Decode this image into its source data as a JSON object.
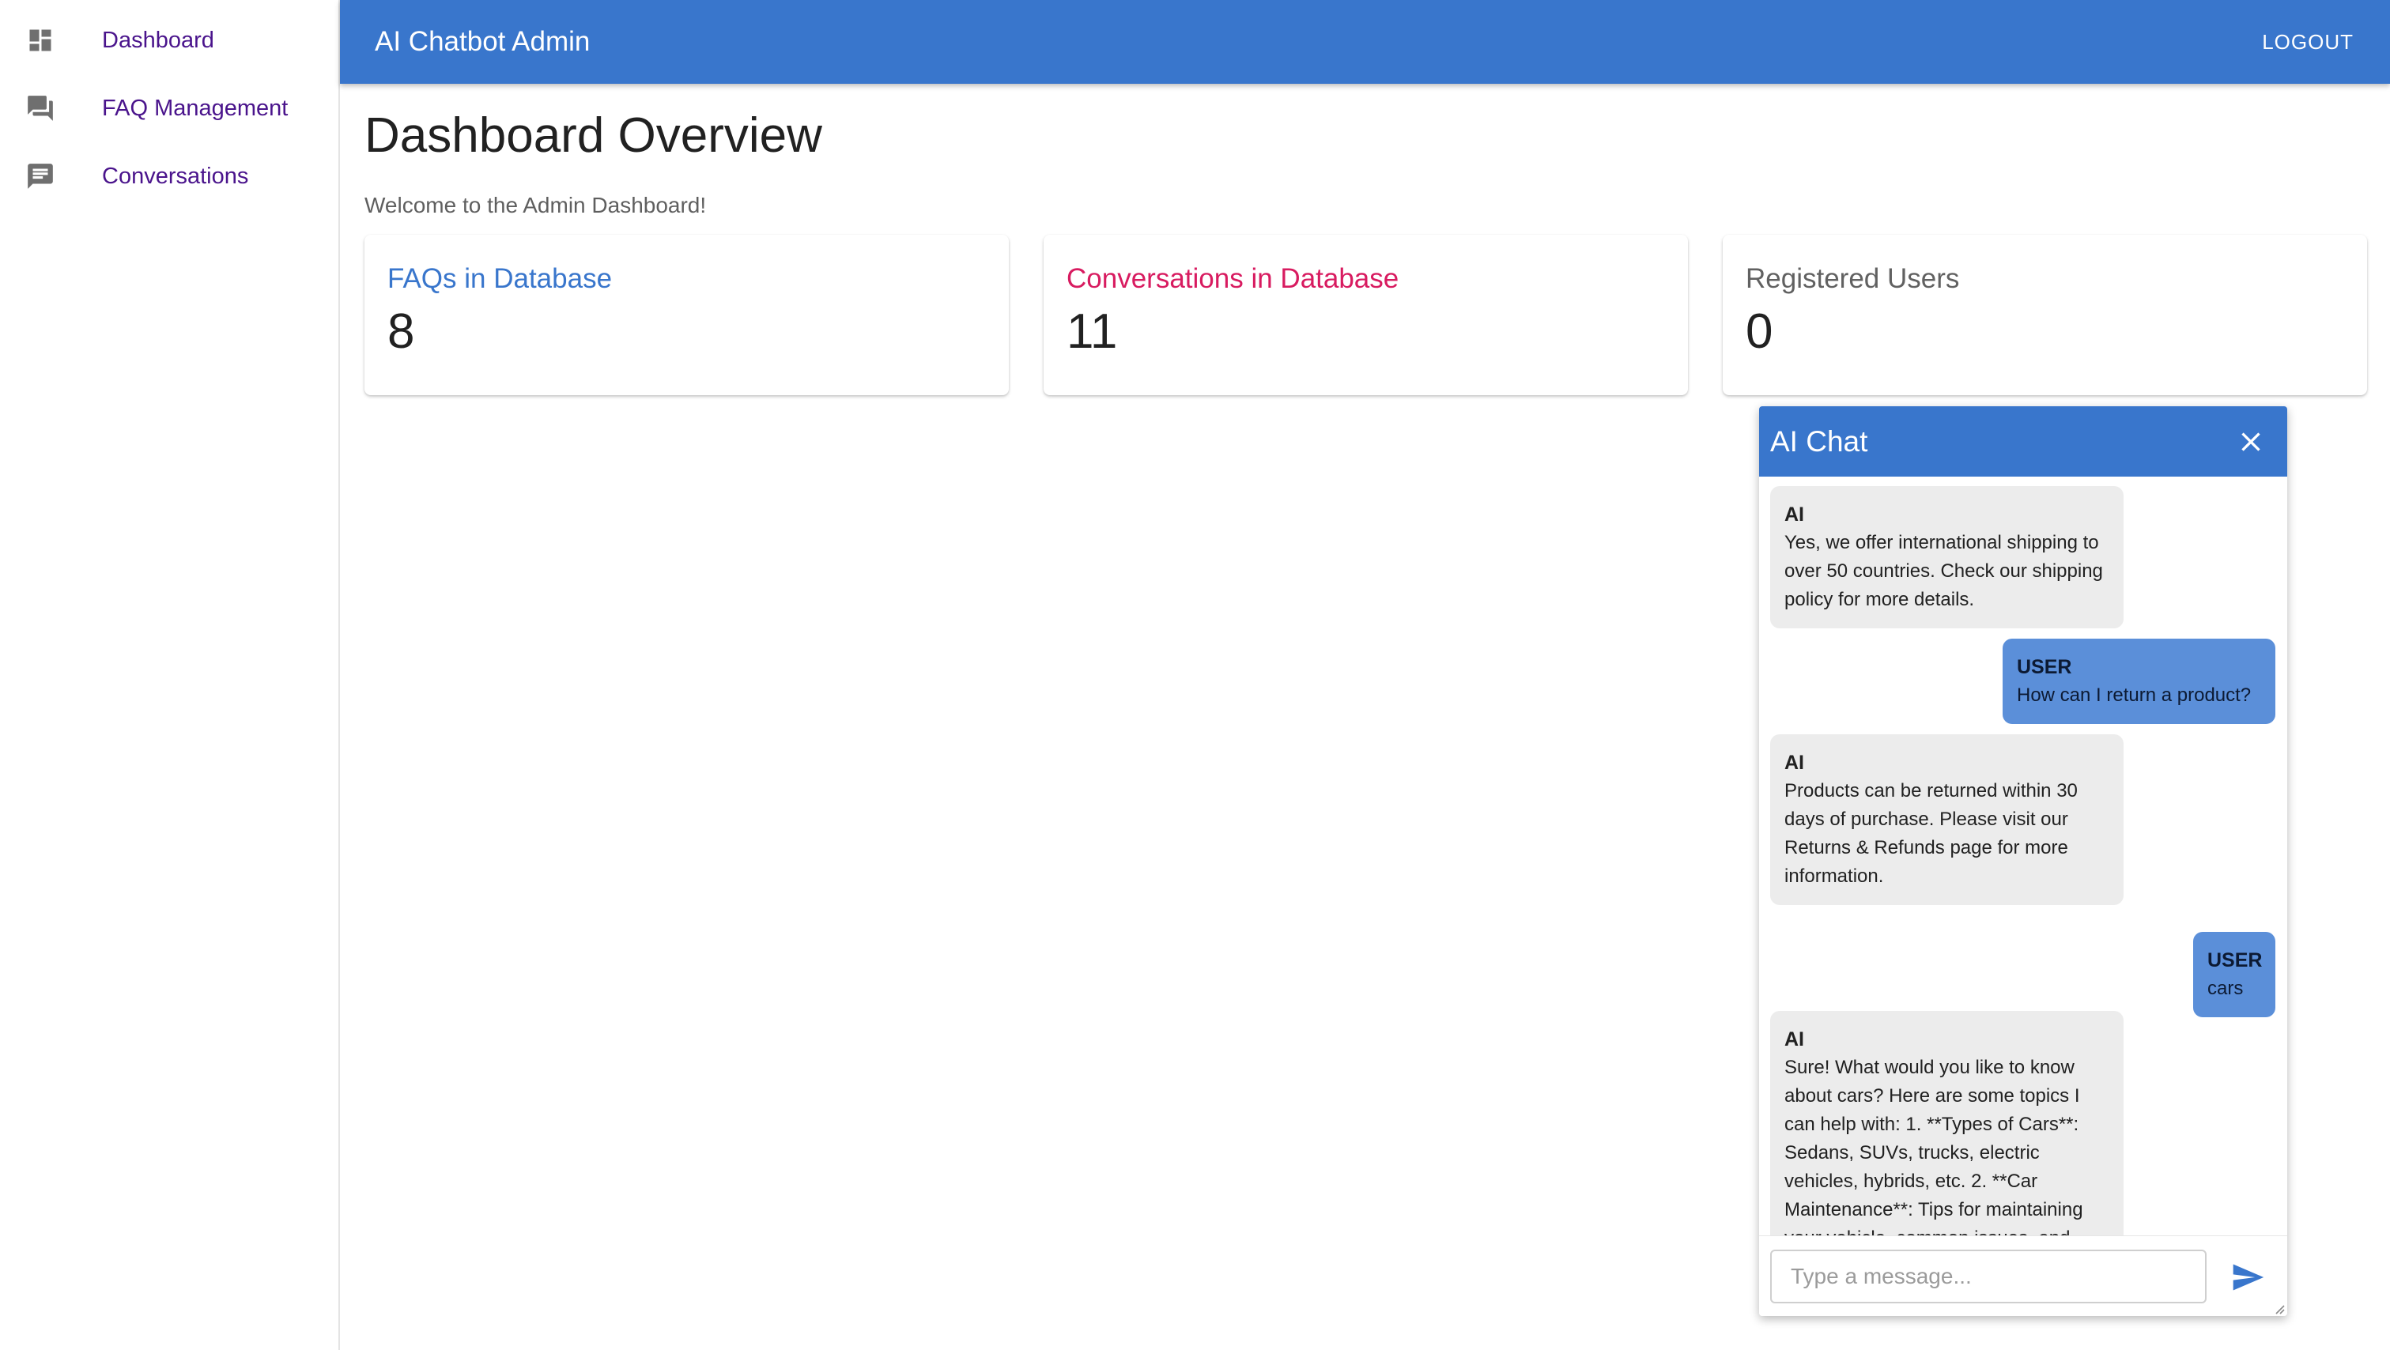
{
  "app": {
    "title": "AI Chatbot Admin",
    "logout_label": "LOGOUT",
    "accent_color": "#3976cc"
  },
  "sidebar": {
    "items": [
      {
        "label": "Dashboard",
        "icon": "dashboard-icon"
      },
      {
        "label": "FAQ Management",
        "icon": "forum-icon"
      },
      {
        "label": "Conversations",
        "icon": "chat-icon"
      }
    ]
  },
  "main": {
    "title": "Dashboard Overview",
    "welcome": "Welcome to the Admin Dashboard!",
    "cards": [
      {
        "title": "FAQs in Database",
        "value": "8",
        "color": "#3976cc"
      },
      {
        "title": "Conversations in Database",
        "value": "11",
        "color": "#d81b60"
      },
      {
        "title": "Registered Users",
        "value": "0",
        "color": "#616161"
      }
    ]
  },
  "chat": {
    "title": "AI Chat",
    "close_icon": "close-icon",
    "send_icon": "send-icon",
    "input_placeholder": "Type a message...",
    "messages": [
      {
        "sender": "AI",
        "text": "Yes, we offer international shipping to over 50 countries. Check our shipping policy for more details."
      },
      {
        "sender": "USER",
        "text": "How can I return a product?"
      },
      {
        "sender": "AI",
        "text": "Products can be returned within 30 days of purchase. Please visit our Returns & Refunds page for more information."
      },
      {
        "sender": "USER",
        "text": "cars"
      },
      {
        "sender": "AI",
        "text": "Sure! What would you like to know about cars? Here are some topics I can help with: 1. **Types of Cars**: Sedans, SUVs, trucks, electric vehicles, hybrids, etc. 2. **Car Maintenance**: Tips for maintaining your vehicle, common issues, and"
      }
    ]
  }
}
